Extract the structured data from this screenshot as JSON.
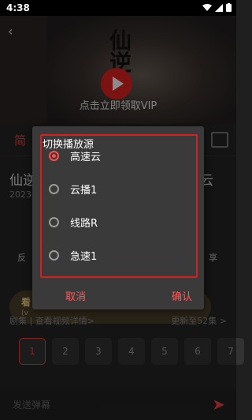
{
  "status": {
    "time": "4:38"
  },
  "video": {
    "logo_text": "仙逆",
    "cta": "点击立即领取VIP"
  },
  "background": {
    "tab_intro": "简",
    "title_left": "仙逆",
    "title_right": "云",
    "year": "2023",
    "action_left": "反",
    "action_right": "享",
    "vip_line1": "看",
    "vip_line2": "(v",
    "episodes_left": "剧集 | 查看视频详情>",
    "episodes_right": "更新至52集 >",
    "episode_numbers": [
      "1",
      "2",
      "3",
      "4",
      "5",
      "6",
      "7"
    ],
    "comment_placeholder": "发送弹幕"
  },
  "dialog": {
    "title": "切换播放源",
    "options": [
      {
        "label": "高速云",
        "selected": true
      },
      {
        "label": "云播1",
        "selected": false
      },
      {
        "label": "线路R",
        "selected": false
      },
      {
        "label": "急速1",
        "selected": false
      }
    ],
    "cancel_label": "取消",
    "confirm_label": "确认"
  },
  "colors": {
    "accent": "#ff4d4d",
    "highlight_border": "#d81f1f",
    "dialog_bg": "#3a3a3a"
  }
}
